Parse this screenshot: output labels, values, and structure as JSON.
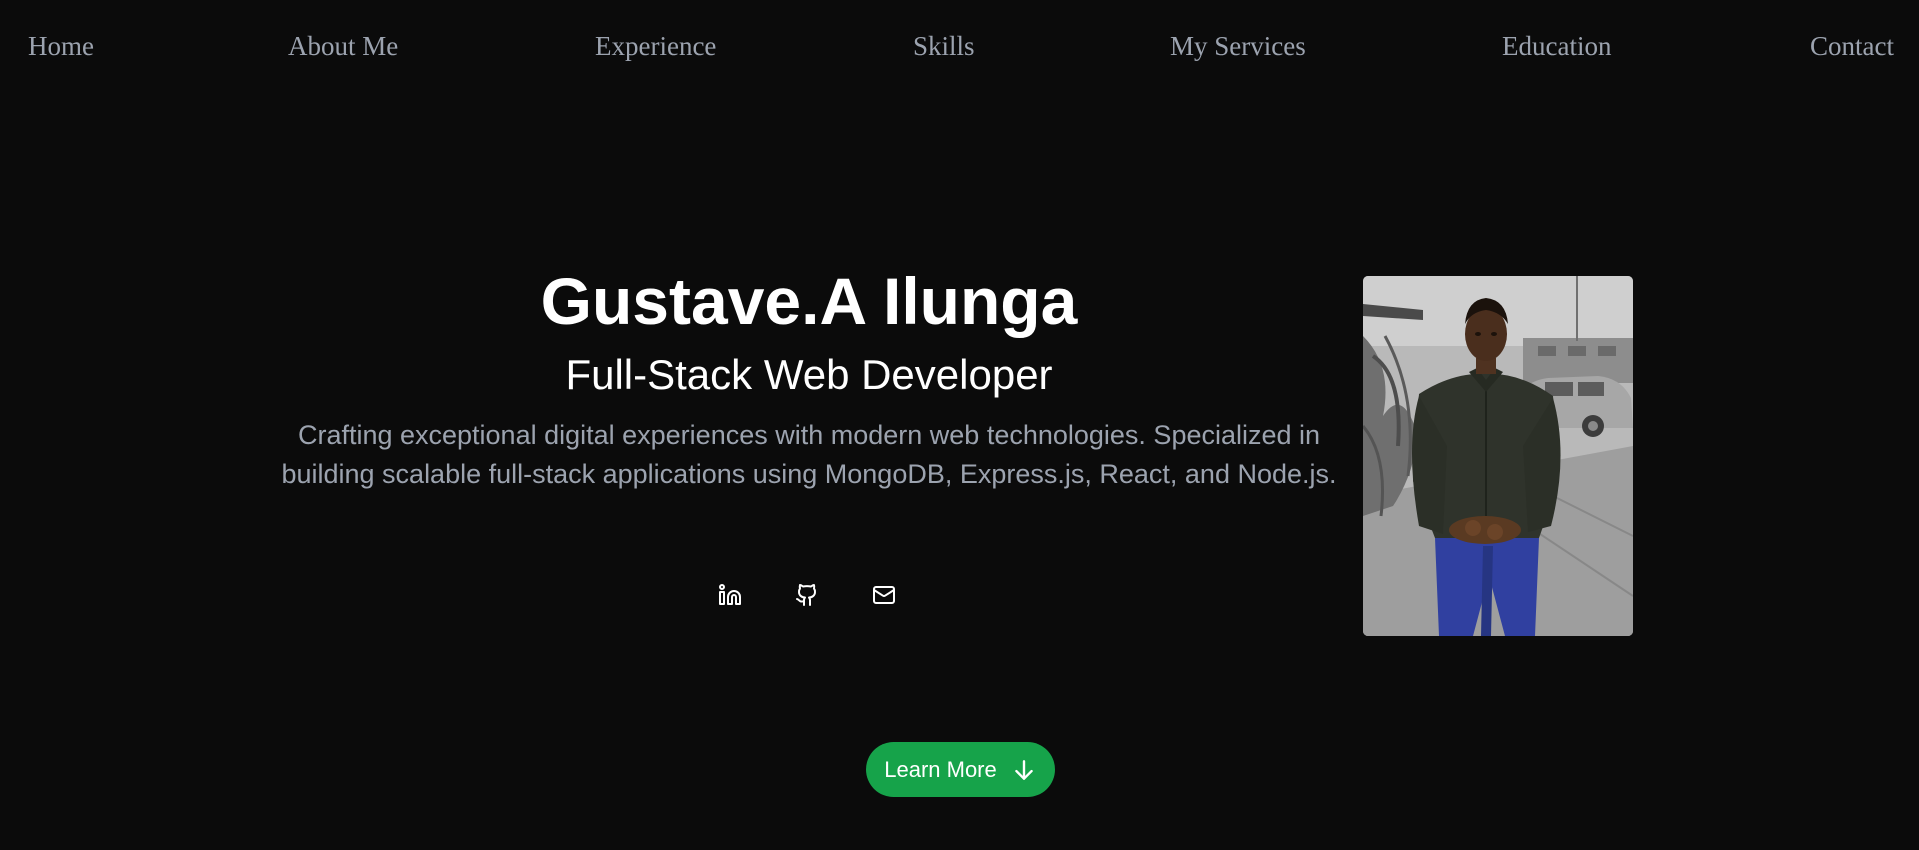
{
  "nav": {
    "items": [
      {
        "label": "Home"
      },
      {
        "label": "About Me"
      },
      {
        "label": "Experience"
      },
      {
        "label": "Skills"
      },
      {
        "label": "My Services"
      },
      {
        "label": "Education"
      },
      {
        "label": "Contact"
      }
    ]
  },
  "hero": {
    "name": "Gustave.A Ilunga",
    "role": "Full-Stack Web Developer",
    "description": "Crafting exceptional digital experiences with modern web technologies. Specialized in building scalable full-stack applications using MongoDB, Express.js, React, and Node.js.",
    "socials": [
      {
        "icon": "linkedin-icon"
      },
      {
        "icon": "github-icon"
      },
      {
        "icon": "mail-icon"
      }
    ],
    "photo": {
      "description": "profile-photo",
      "style": "grayscale with colored subject"
    }
  },
  "cta": {
    "label": "Learn More",
    "icon": "arrow-down-icon"
  },
  "colors": {
    "background": "#0b0b0b",
    "nav_text": "#9ca3af",
    "heading": "#ffffff",
    "body_text": "#9ca3af",
    "accent": "#16a34a"
  }
}
